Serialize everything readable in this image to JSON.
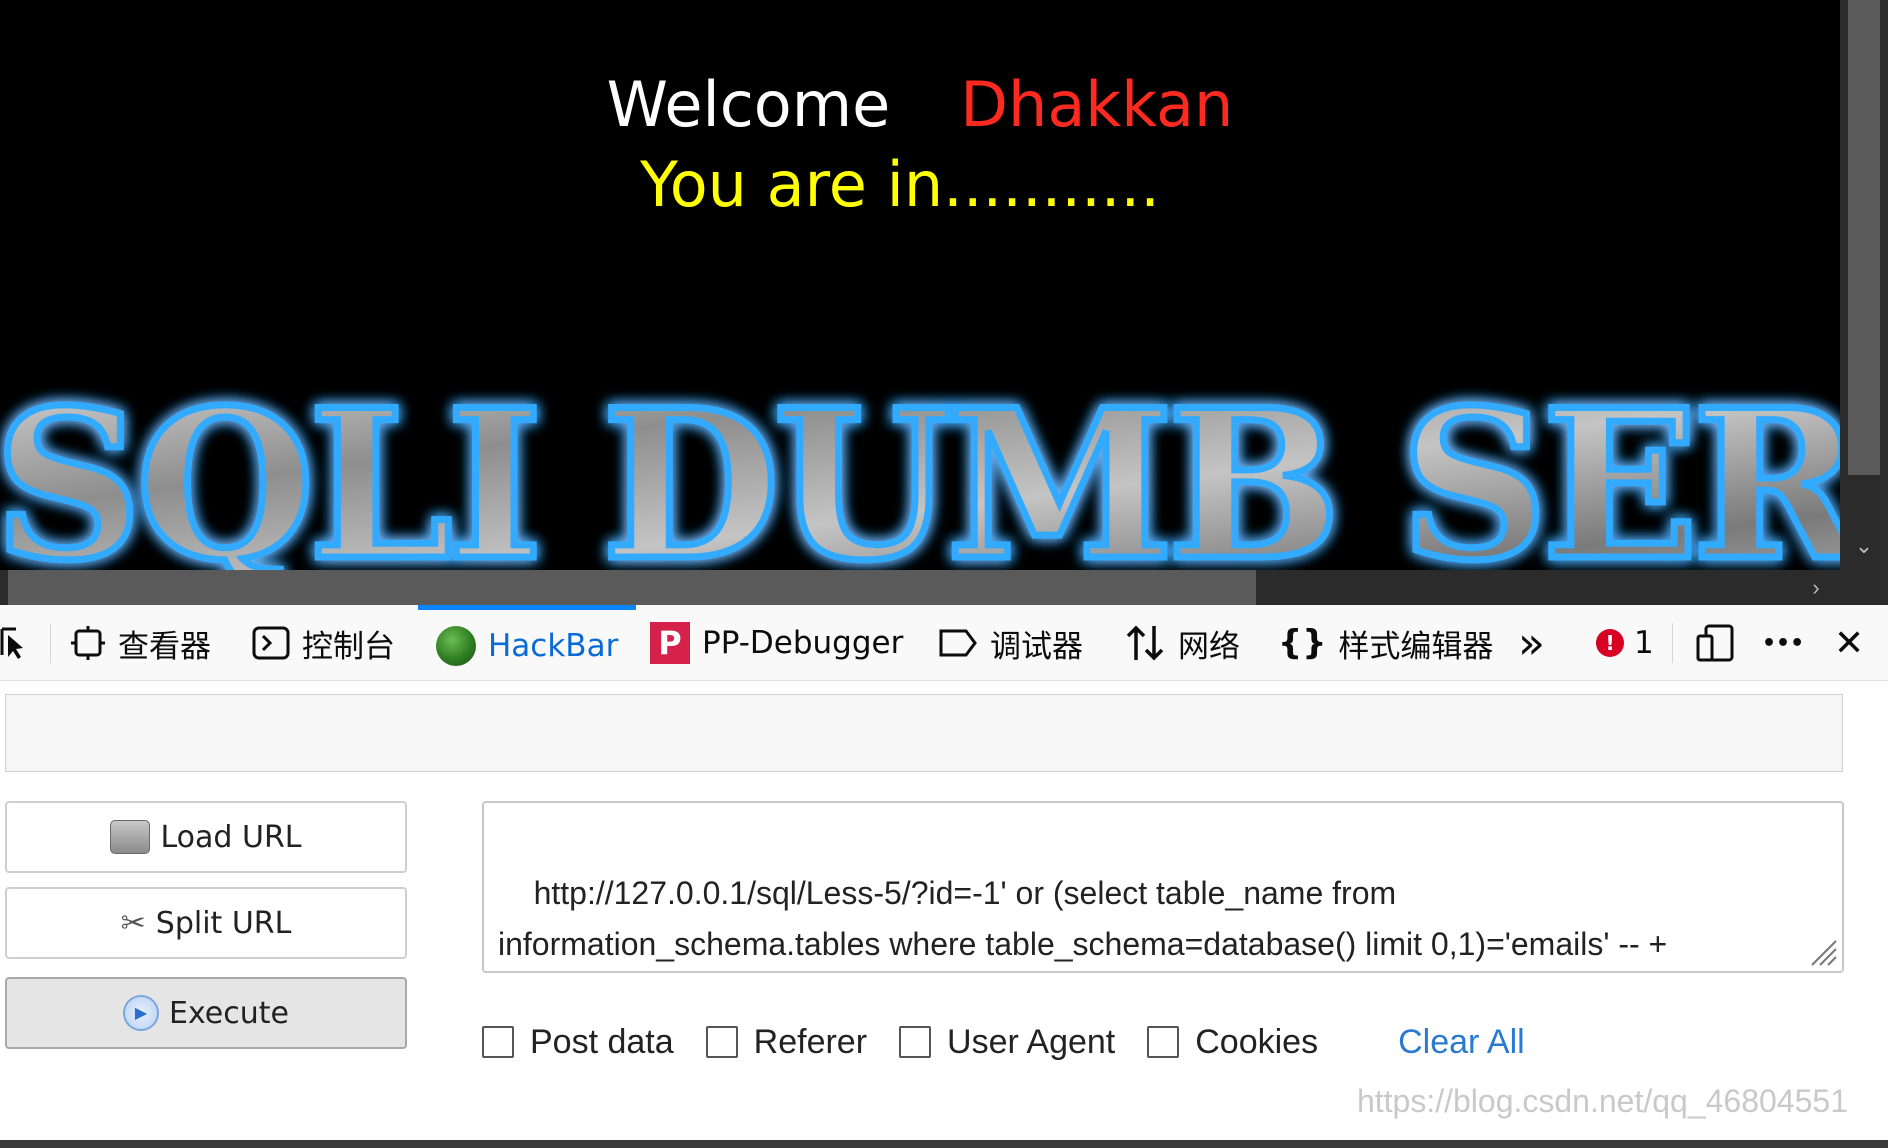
{
  "page": {
    "welcome_word": "Welcome",
    "user_name": "Dhakkan",
    "status": "You are in...........",
    "banner_text": "SQLI DUMB SER"
  },
  "devtools": {
    "tabs": [
      {
        "label": "",
        "icon": "element-picker-icon"
      },
      {
        "label": "查看器",
        "icon": "inspector-icon"
      },
      {
        "label": "控制台",
        "icon": "console-icon"
      },
      {
        "label": "HackBar",
        "icon": "hackbar-icon",
        "active": true
      },
      {
        "label": "PP-Debugger",
        "icon": "pp-debugger-icon"
      },
      {
        "label": "调试器",
        "icon": "debugger-icon"
      },
      {
        "label": "网络",
        "icon": "network-icon"
      },
      {
        "label": "样式编辑器",
        "icon": "style-editor-icon"
      }
    ],
    "overflow_glyph": "»",
    "error_count": "1",
    "close_glyph": "✕",
    "more_glyph": "•••"
  },
  "hackbar": {
    "load_url": "Load URL",
    "split_url": "Split URL",
    "execute": "Execute",
    "url_value": "http://127.0.0.1/sql/Less-5/?id=-1' or (select table_name from\ninformation_schema.tables where table_schema=database() limit 0,1)='emails' -- +",
    "options": [
      "Post data",
      "Referer",
      "User Agent",
      "Cookies"
    ],
    "clear_all": "Clear All"
  },
  "watermark": "https://blog.csdn.net/qq_46804551",
  "colors": {
    "welcome": "#ffffff",
    "user_name": "#ff2a1f",
    "status": "#ffff00",
    "banner_glow": "#1e9bff",
    "active_tab": "#0a84ff",
    "link": "#2a7ad2"
  }
}
